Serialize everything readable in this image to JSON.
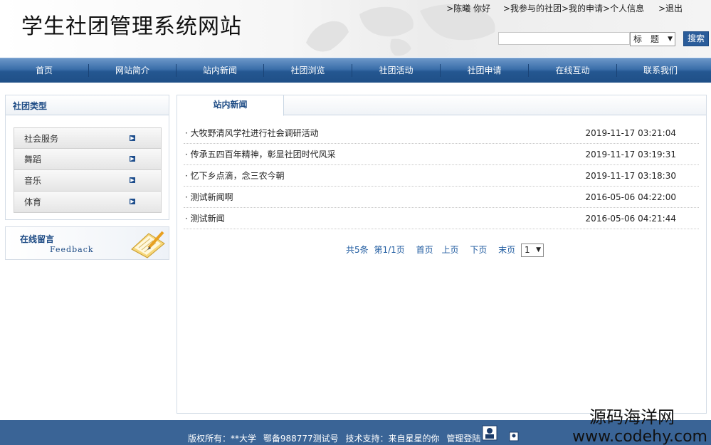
{
  "header": {
    "site_title": "学生社团管理系统网站",
    "user_greeting": ">陈曦 你好",
    "links": [
      ">我参与的社团",
      ">我的申请",
      ">个人信息",
      ">退出"
    ],
    "search_placeholder": "",
    "search_field_select": "标　题",
    "search_button": "搜索"
  },
  "nav": {
    "items": [
      "首页",
      "网站简介",
      "站内新闻",
      "社团浏览",
      "社团活动",
      "社团申请",
      "在线互动",
      "联系我们"
    ]
  },
  "sidebar": {
    "category_title": "社团类型",
    "categories": [
      "社会服务",
      "舞蹈",
      "音乐",
      "体育"
    ],
    "feedback_title": "在线留言",
    "feedback_subtitle": "Feedback"
  },
  "main": {
    "tab_label": "站内新闻",
    "news": [
      {
        "title": "· 大牧野清风学社进行社会调研活动",
        "date": "2019-11-17 03:21:04"
      },
      {
        "title": "· 传承五四百年精神，彰显社团时代风采",
        "date": "2019-11-17 03:19:31"
      },
      {
        "title": "· 忆下乡点滴，念三农今朝",
        "date": "2019-11-17 03:18:30"
      },
      {
        "title": "· 测试新闻啊",
        "date": "2016-05-06 04:22:00"
      },
      {
        "title": "· 测试新闻",
        "date": "2016-05-06 04:21:44"
      }
    ],
    "pager": {
      "total": "共5条",
      "page_info": "第1/1页",
      "first": "首页",
      "prev": "上页",
      "next": "下页",
      "last": "末页",
      "page_select": "1"
    }
  },
  "footer": {
    "copyright": "版权所有：**大学",
    "icp": "鄂备988777测试号",
    "support": "技术支持：来自星星的你",
    "admin_login": "管理登陆"
  },
  "watermark": {
    "line1": "源码海洋网",
    "line2": "www.codehy.com"
  },
  "colors": {
    "nav_dark": "#1f4f87",
    "accent_blue": "#1c4a84",
    "link_blue": "#1f5ba0",
    "footer_bg": "#3a6496"
  }
}
